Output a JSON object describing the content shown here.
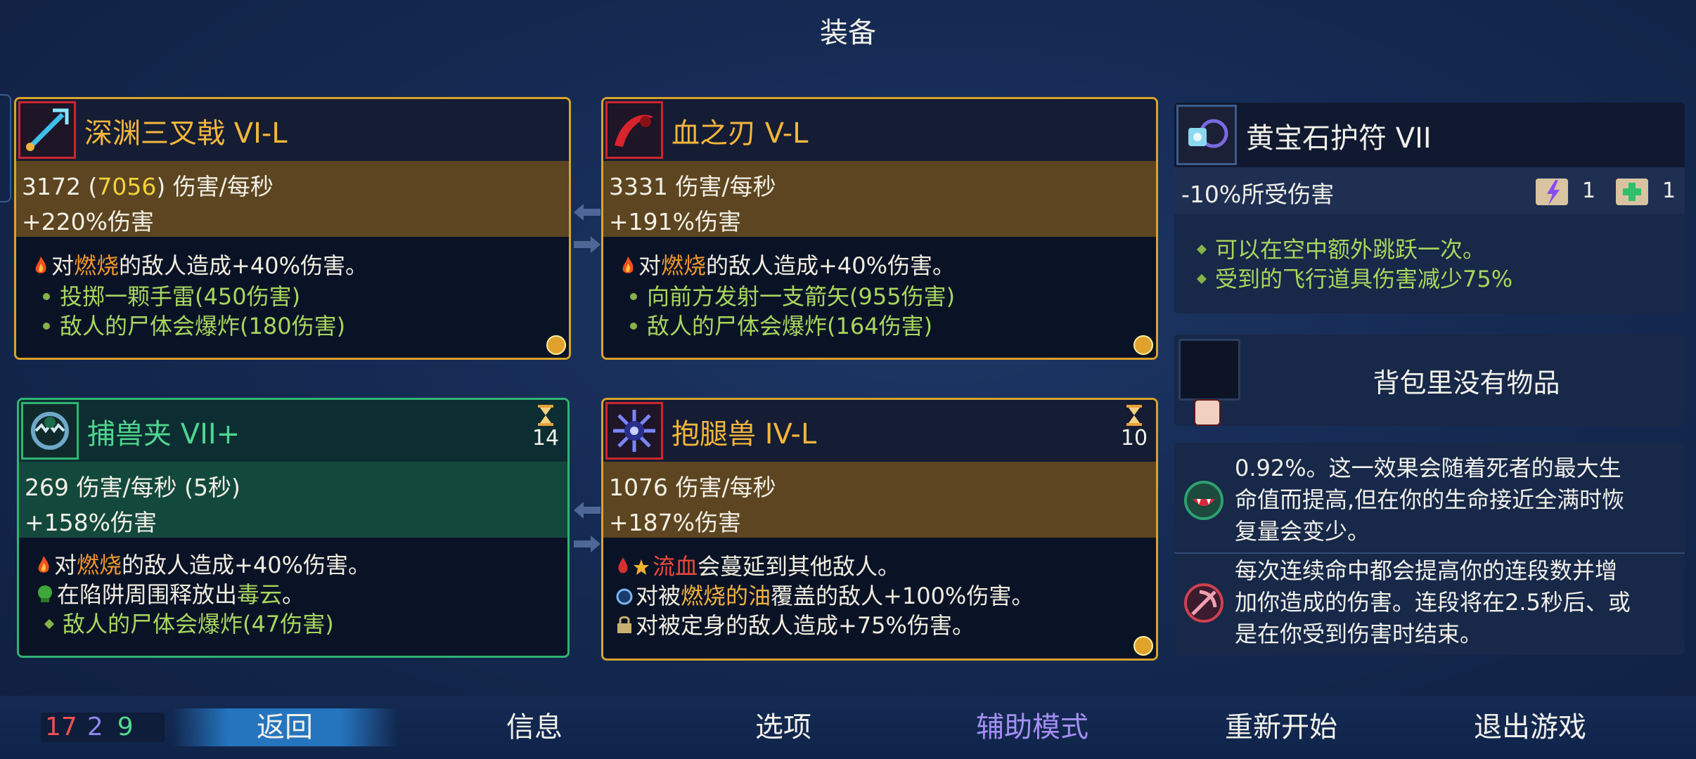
{
  "screen_title": "装备",
  "weapons": [
    {
      "name": "深渊三叉戟 VI-L",
      "dps": "3172 (",
      "dps_highlight": "7056",
      "dps_rest": ") 伤害/每秒",
      "bonus": "+220%伤害",
      "effects": [
        {
          "pre": "对",
          "kw": "燃烧",
          "post": "的敌人造成+40%伤害。"
        },
        {
          "text": "投掷一颗手雷(450伤害)"
        },
        {
          "text": "敌人的尸体会爆炸(180伤害)"
        }
      ]
    },
    {
      "name": "血之刃 V-L",
      "dps": "3331 伤害/每秒",
      "bonus": "+191%伤害",
      "effects": [
        {
          "pre": "对",
          "kw": "燃烧",
          "post": "的敌人造成+40%伤害。"
        },
        {
          "text": "向前方发射一支箭矢(955伤害)"
        },
        {
          "text": "敌人的尸体会爆炸(164伤害)"
        }
      ]
    },
    {
      "name": "捕兽夹 VII+",
      "cooldown": "14",
      "dps": "269 伤害/每秒 (5秒)",
      "bonus": "+158%伤害",
      "effects": [
        {
          "pre": "对",
          "kw": "燃烧",
          "post": "的敌人造成+40%伤害。"
        },
        {
          "pre": "在陷阱周围释放出",
          "kw2": "毒云",
          "post": "。"
        },
        {
          "text": "敌人的尸体会爆炸(47伤害)"
        }
      ]
    },
    {
      "name": "抱腿兽 IV-L",
      "cooldown": "10",
      "dps": "1076 伤害/每秒",
      "bonus": "+187%伤害",
      "effects": [
        {
          "kw": "流血",
          "post": "会蔓延到其他敌人。"
        },
        {
          "pre": "对被",
          "kw": "燃烧的油",
          "post": "覆盖的敌人+100%伤害。"
        },
        {
          "pre": "对被定身的敌人造成+75%伤害。"
        }
      ]
    }
  ],
  "amulet": {
    "name": "黄宝石护符 VII",
    "stat": "-10%所受伤害",
    "scroll1_count": "1",
    "scroll2_count": "1",
    "effects": [
      "可以在空中额外跳跃一次。",
      "受到的飞行道具伤害减少75%"
    ]
  },
  "backpack": {
    "empty_text": "背包里没有物品"
  },
  "mutations": [
    {
      "text_lines": [
        "0.92%。这一效果会随着死者的最大生",
        "命值而提高,但在你的生命接近全满时恢",
        "复量会变少。"
      ]
    },
    {
      "text_lines": [
        "每次连续命中都会提高你的连段数并增",
        "加你造成的伤害。连段将在2.5秒后、或",
        "是在你受到伤害时结束。"
      ]
    }
  ],
  "stats": {
    "brutality": "17",
    "tactics": "2",
    "survival": "9"
  },
  "nav": [
    "返回",
    "信息",
    "选项",
    "辅助模式",
    "重新开始",
    "退出游戏"
  ],
  "colors": {
    "gold_border": "#d9a32c",
    "green_border": "#2fb472",
    "keyword_orange": "#f0962c",
    "effect_green": "#a8d65e",
    "assist_purple": "#a48ef2"
  }
}
